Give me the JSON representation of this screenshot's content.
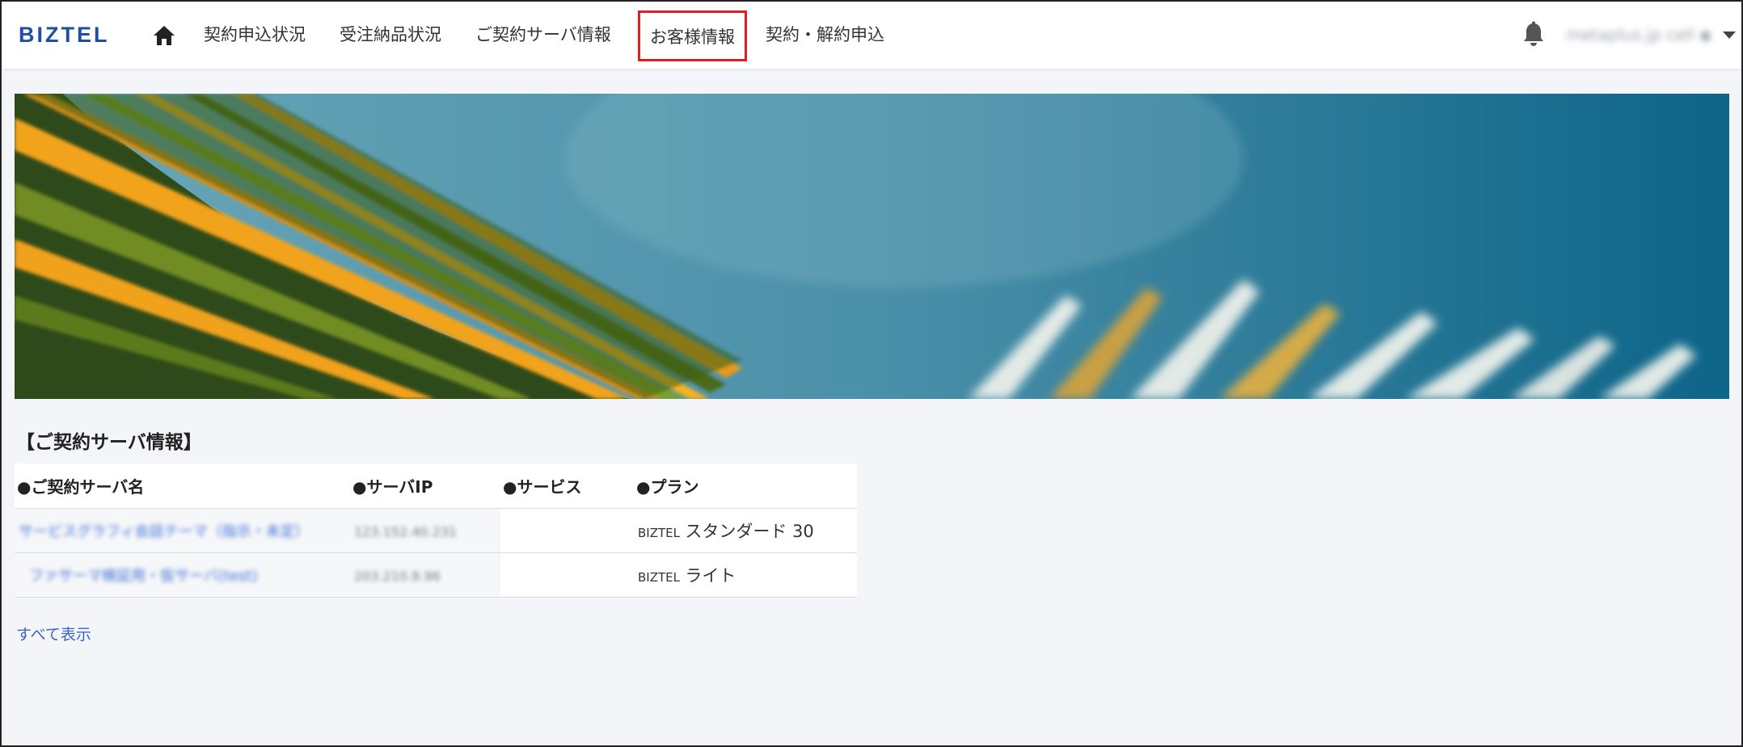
{
  "header": {
    "logo": "BIZTEL",
    "nav": [
      "契約申込状況",
      "受注納品状況",
      "ご契約サーバ情報",
      "お客様情報",
      "契約・解約申込"
    ],
    "active_nav": "お客様情報",
    "user_name": "metaplus.jp cell ◆",
    "icons": [
      "home-icon",
      "bell-icon",
      "caret-down-icon"
    ]
  },
  "section": {
    "title": "【ご契約サーバ情報】",
    "columns": [
      "●ご契約サーバ名",
      "●サーバIP",
      "●サービス",
      "●プラン"
    ],
    "rows": [
      {
        "server_name": "サービスグラフィ会話テーマ（指示・未定）",
        "server_ip": "123.152.40.231",
        "service": "",
        "plan_prefix": "BIZTEL",
        "plan_name": "スタンダード 30"
      },
      {
        "server_name": "ファサーマ検証用・仮サーバ(test)",
        "server_ip": "203.210.8.96",
        "service": "",
        "plan_prefix": "BIZTEL",
        "plan_name": "ライト"
      }
    ],
    "show_all_label": "すべて表示"
  },
  "colors": {
    "brand": "#1f4fa5",
    "active_outline": "#e02020",
    "link": "#3a63c8",
    "page_bg": "#f4f5f8"
  }
}
